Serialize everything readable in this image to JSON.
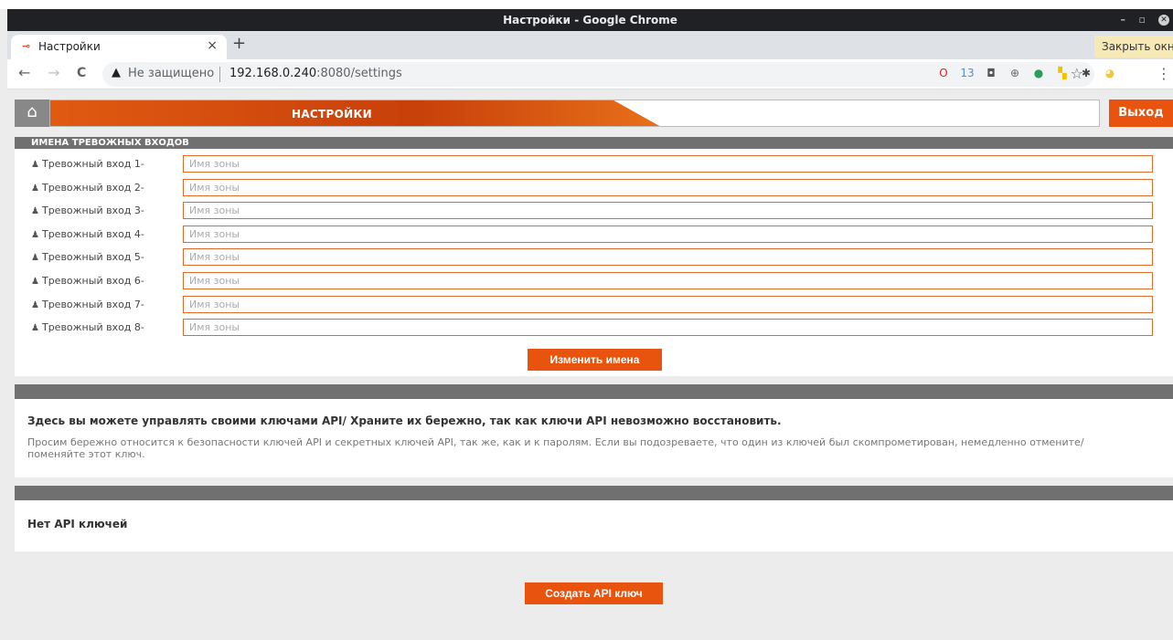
{
  "window": {
    "title": "Настройки - Google Chrome",
    "min_glyph": "–",
    "max_glyph": "▫",
    "close_glyph": "✕"
  },
  "tab": {
    "favicon": "⊸",
    "title": "Настройки",
    "close_glyph": "×",
    "new_tab_glyph": "+"
  },
  "tooltip": {
    "text": "Закрыть окно"
  },
  "toolbar": {
    "back_glyph": "←",
    "forward_glyph": "→",
    "reload_glyph": "C",
    "security_icon": "▲",
    "security_text": "Не защищено",
    "url_host": "192.168.0.240",
    "url_path": ":8080/settings",
    "star_glyph": "☆",
    "menu_glyph": "⋮"
  },
  "extensions": [
    {
      "name": "opera-icon",
      "glyph": "O",
      "color": "#e01e1e"
    },
    {
      "name": "calendar-icon",
      "glyph": "13",
      "color": "#4a90d9"
    },
    {
      "name": "screen-icon",
      "glyph": "◘",
      "color": "#555555"
    },
    {
      "name": "globe-icon",
      "glyph": "⊕",
      "color": "#666666"
    },
    {
      "name": "earth-icon",
      "glyph": "●",
      "color": "#2a9d5c"
    },
    {
      "name": "flag-icon",
      "glyph": "▚",
      "color": "#f2c200"
    },
    {
      "name": "puzzle-icon",
      "glyph": "✱",
      "color": "#444444"
    },
    {
      "name": "avatar-icon",
      "glyph": "◕",
      "color": "#f5c542"
    }
  ],
  "header": {
    "home_glyph": "⌂",
    "title": "НАСТРОЙКИ",
    "logout": "Выход"
  },
  "alarm_inputs": {
    "title": "ИМЕНА ТРЕВОЖНЫХ ВХОДОВ",
    "bell_glyph": "♟",
    "placeholder": "Имя зоны",
    "rows": [
      {
        "label": "Тревожный вход 1-"
      },
      {
        "label": "Тревожный вход 2-"
      },
      {
        "label": "Тревожный вход 3-"
      },
      {
        "label": "Тревожный вход 4-"
      },
      {
        "label": "Тревожный вход 5-"
      },
      {
        "label": "Тревожный вход 6-"
      },
      {
        "label": "Тревожный вход 7-"
      },
      {
        "label": "Тревожный вход 8-"
      }
    ],
    "rename_button": "Изменить имена"
  },
  "api_info": {
    "heading": "Здесь вы можете управлять своими ключами API/ Храните их бережно, так как ключи API невозможно восстановить.",
    "description": "Просим бережно относится к безопасности ключей API и секретных ключей API, так же, как и к паролям. Если вы подозреваете, что один из ключей был скомпрометирован, немедленно отмените/поменяйте этот ключ."
  },
  "api_list": {
    "empty_text": "Нет API ключей"
  },
  "create_button": "Создать API ключ"
}
